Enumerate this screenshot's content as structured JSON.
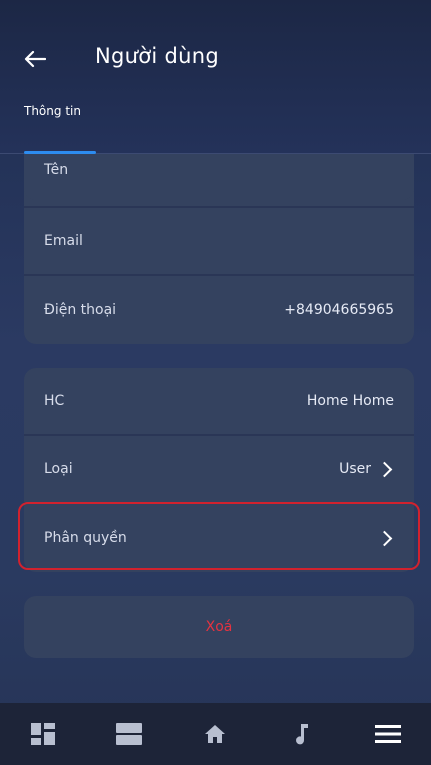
{
  "header": {
    "title": "Người dùng",
    "back_icon": "arrow-left-icon"
  },
  "tabs": [
    {
      "label": "Thông tin",
      "active": true
    }
  ],
  "info_fields": [
    {
      "label": "Tên",
      "value": ""
    },
    {
      "label": "Email",
      "value": ""
    },
    {
      "label": "Điện thoại",
      "value": "+84904665965"
    }
  ],
  "settings_fields": [
    {
      "label": "HC",
      "value": "Home Home",
      "has_chevron": false
    },
    {
      "label": "Loại",
      "value": "User",
      "has_chevron": true
    },
    {
      "label": "Phân quyền",
      "value": "",
      "has_chevron": true,
      "highlighted": true
    }
  ],
  "delete_button": {
    "label": "Xoá"
  },
  "bottom_nav": [
    {
      "icon": "dashboard-icon"
    },
    {
      "icon": "rooms-icon"
    },
    {
      "icon": "home-icon"
    },
    {
      "icon": "music-icon"
    },
    {
      "icon": "menu-icon"
    }
  ],
  "colors": {
    "accent": "#2d8cf0",
    "danger": "#e53340",
    "highlight_border": "#d2222e",
    "card": "#34425f",
    "nav_bg": "#1d2438"
  }
}
